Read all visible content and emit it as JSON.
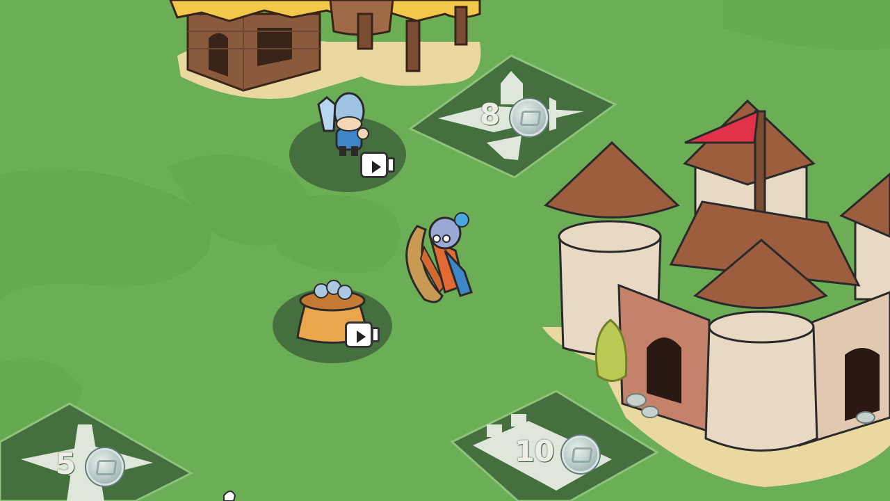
{
  "build_spots": [
    {
      "id": "barracks",
      "cost": "8",
      "currency_icon": "silver-coin-icon",
      "silhouette_icon": "crossed-swords-icon"
    },
    {
      "id": "windmill",
      "cost": "5",
      "currency_icon": "silver-coin-icon",
      "silhouette_icon": "windmill-icon"
    },
    {
      "id": "wall",
      "cost": "10",
      "currency_icon": "silver-coin-icon",
      "silhouette_icon": "castle-wall-icon"
    }
  ],
  "reward_spots": [
    {
      "id": "knight-reward",
      "icon": "knight-icon",
      "action_icon": "video-ad-icon"
    },
    {
      "id": "coin-sack-reward",
      "icon": "coin-sack-icon",
      "action_icon": "video-ad-icon"
    }
  ],
  "player": {
    "icon": "archer-hero-icon"
  },
  "colors": {
    "grass": "#6cae55",
    "tile": "#456f3e",
    "tile_border": "#8cc47a",
    "coin": "#c7d6d4",
    "flag": "#e2324a",
    "roof": "#9c5e3e",
    "wall": "#e8d9c4",
    "thatch": "#f2c84b"
  }
}
